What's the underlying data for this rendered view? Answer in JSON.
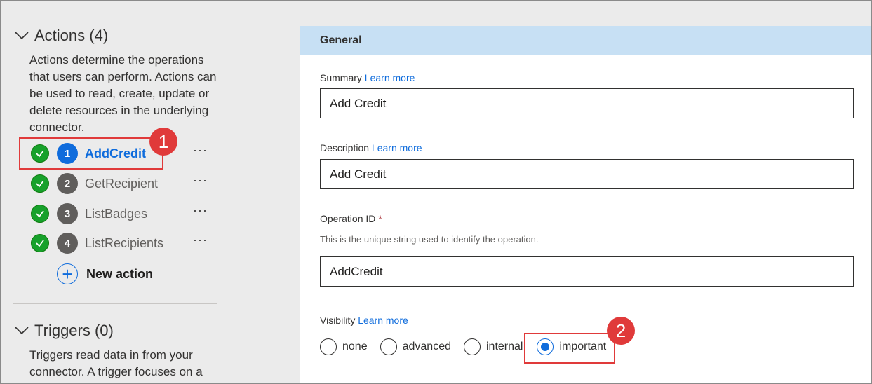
{
  "actions_section": {
    "title": "Actions (4)",
    "description": "Actions determine the operations that users can perform. Actions can be used to read, create, update or delete resources in the underlying connector.",
    "items": [
      {
        "number": "1",
        "name": "AddCredit",
        "active": true
      },
      {
        "number": "2",
        "name": "GetRecipient",
        "active": false
      },
      {
        "number": "3",
        "name": "ListBadges",
        "active": false
      },
      {
        "number": "4",
        "name": "ListRecipients",
        "active": false
      }
    ],
    "more_label": "···",
    "new_action_label": "New action"
  },
  "triggers_section": {
    "title": "Triggers (0)",
    "description": "Triggers read data in from your connector. A trigger focuses on a"
  },
  "general": {
    "header": "General",
    "learn_more": "Learn more",
    "summary_label": "Summary",
    "summary_value": "Add Credit",
    "description_label": "Description",
    "description_value": "Add Credit",
    "operation_id_label": "Operation ID",
    "required_mark": "*",
    "operation_id_help": "This is the unique string used to identify the operation.",
    "operation_id_value": "AddCredit",
    "visibility_label": "Visibility",
    "visibility_options": [
      "none",
      "advanced",
      "internal",
      "important"
    ],
    "visibility_selected": "important"
  },
  "annotations": [
    "1",
    "2"
  ],
  "colors": {
    "accent": "#0f6cdc",
    "success": "#17a12b",
    "callout": "#e03a3a",
    "header_bg": "#c7e0f4"
  }
}
